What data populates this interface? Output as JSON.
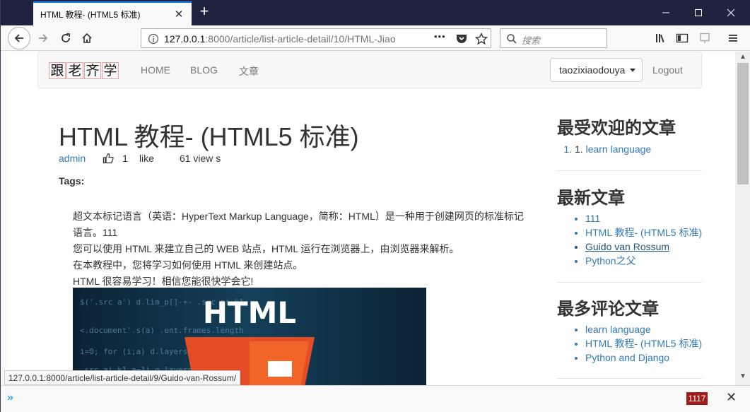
{
  "browser": {
    "tab_title": "HTML 教程- (HTML5 标准)",
    "tab_close": "✕",
    "new_tab": "+",
    "url_host": "127.0.0.1",
    "url_rest": ":8000/article/list-article-detail/10/HTML-Jiao",
    "search_placeholder": "搜索",
    "page_actions": "•••"
  },
  "site": {
    "brand_chars": [
      "跟",
      "老",
      "齐",
      "学"
    ],
    "nav": {
      "home": "HOME",
      "blog": "BLOG",
      "article": "文章"
    },
    "user_menu": "taozixiaodouya",
    "logout": "Logout"
  },
  "article": {
    "title": "HTML 教程- (HTML5 标准)",
    "author": "admin",
    "likes": "1",
    "like_word": "like",
    "views": "61 view s",
    "tags_label": "Tags:",
    "paragraphs": [
      "超文本标记语言（英语：HyperText Markup Language，简称：HTML）是一种用于创建网页的标准标记语言。111",
      "您可以使用 HTML 来建立自己的 WEB 站点，HTML 运行在浏览器上，由浏览器来解析。",
      "在本教程中，您将学习如何使用 HTML 来创建站点。",
      "HTML 很容易学习！相信您能很快学会它!"
    ],
    "image_text": "HTML"
  },
  "sidebar": {
    "popular": {
      "heading": "最受欢迎的文章",
      "items": [
        "learn language"
      ]
    },
    "latest": {
      "heading": "最新文章",
      "items": [
        "111",
        "HTML 教程- (HTML5 标准)",
        "Guido van Rossum",
        "Python之父"
      ]
    },
    "most_commented": {
      "heading": "最多评论文章",
      "items": [
        "learn language",
        "HTML 教程- (HTML5 标准)",
        "Python and Django"
      ]
    }
  },
  "status_url": "127.0.0.1:8000/article/list-article-detail/9/Guido-van-Rossum/",
  "bottom_bar": {
    "badge": "1117"
  },
  "colors": {
    "link": "#337ab7",
    "tab_accent": "#0a84ff",
    "titlebar": "#202340",
    "badge": "#a11a1a"
  }
}
